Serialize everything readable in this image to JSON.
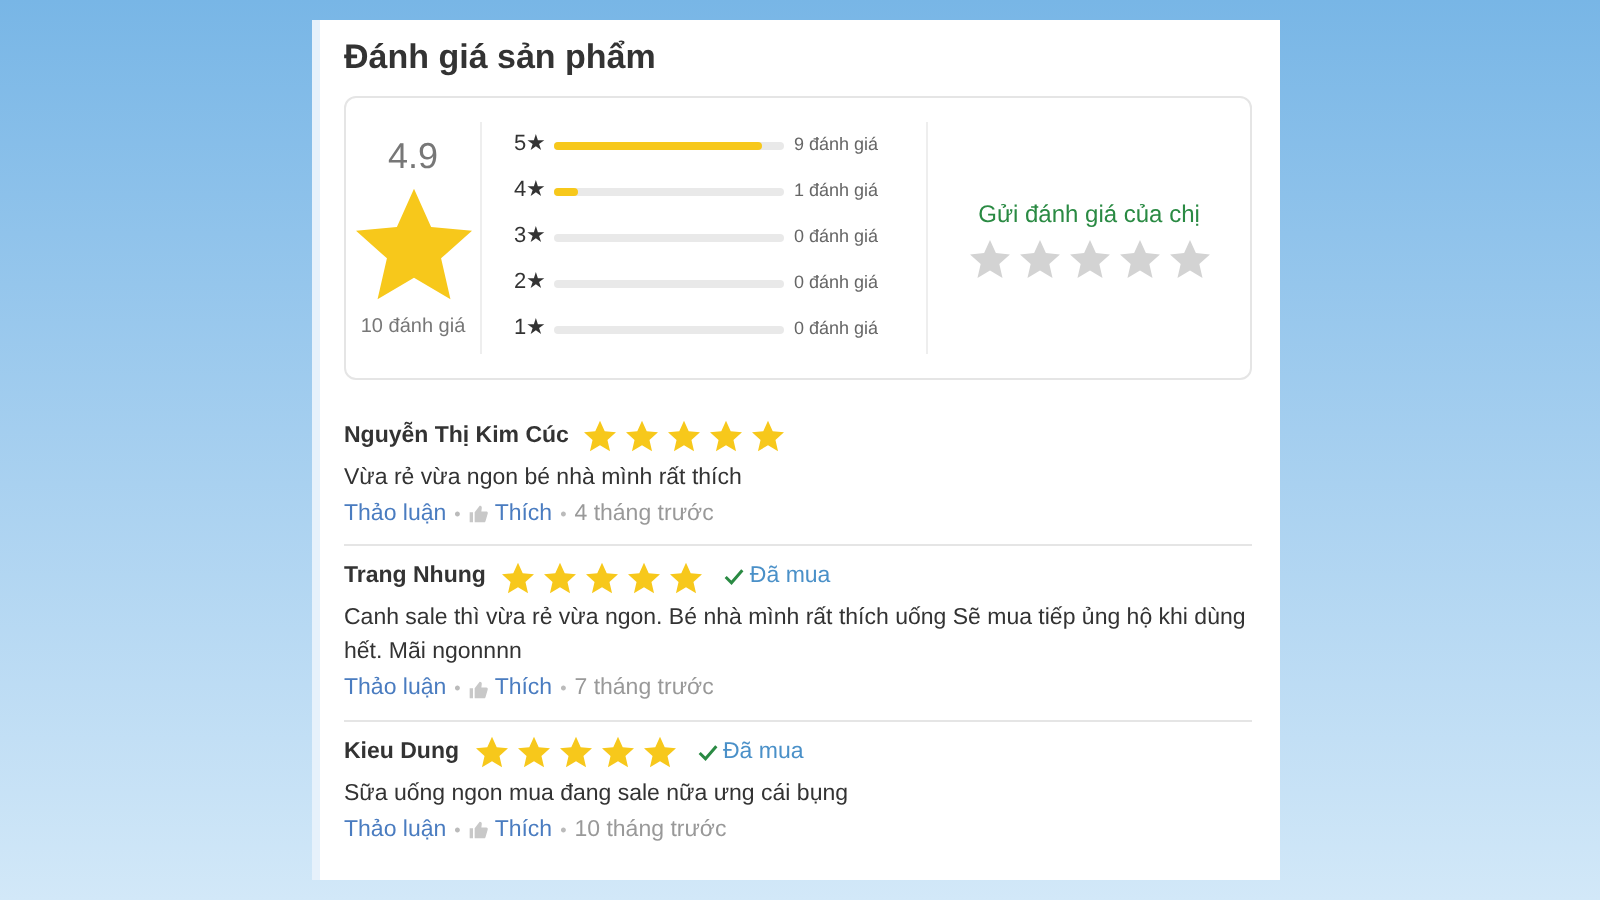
{
  "title": "Đánh giá sản phẩm",
  "separator": "•",
  "summary": {
    "average": "4.9",
    "count": "10 đánh giá",
    "bars": [
      {
        "label": "5★",
        "level": 0.9,
        "count": "9 đánh giá"
      },
      {
        "label": "4★",
        "level": 0.1,
        "count": "1 đánh giá"
      },
      {
        "label": "3★",
        "level": 0,
        "count": "0 đánh giá"
      },
      {
        "label": "2★",
        "level": 0,
        "count": "0 đánh giá"
      },
      {
        "label": "1★",
        "level": 0,
        "count": "0 đánh giá"
      }
    ],
    "submit": {
      "label": "Gửi đánh giá của chị",
      "stars": 0
    }
  },
  "reviews": [
    {
      "name": "Nguyễn Thị Kim Cúc",
      "stars": 5,
      "purchased": false,
      "text": "Vừa rẻ vừa ngon bé nhà mình rất thích",
      "discuss": "Thảo luận",
      "like": "Thích",
      "time": "4 tháng trước"
    },
    {
      "name": "Trang Nhung",
      "stars": 5,
      "purchased": true,
      "purchased_label": "Đã mua",
      "text": "Canh sale thì vừa rẻ vừa ngon. Bé nhà mình rất thích uống Sẽ mua tiếp ủng hộ khi dùng hết. Mãi ngonnnn",
      "discuss": "Thảo luận",
      "like": "Thích",
      "time": "7 tháng trước"
    },
    {
      "name": "Kieu Dung",
      "stars": 5,
      "purchased": true,
      "purchased_label": "Đã mua",
      "text": "Sữa uống ngon mua đang sale nữa ưng cái bụng",
      "discuss": "Thảo luận",
      "like": "Thích",
      "time": "10 tháng trước"
    }
  ]
}
